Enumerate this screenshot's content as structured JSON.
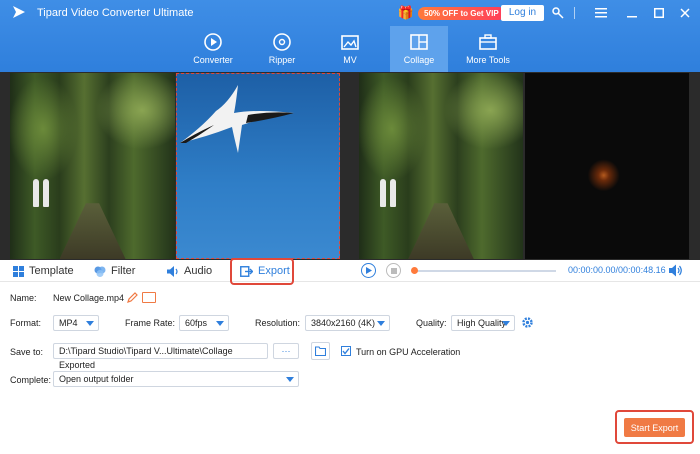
{
  "app": {
    "title": "Tipard Video Converter Ultimate",
    "promo": "50% OFF to Get VIP",
    "login": "Log in"
  },
  "nav": [
    {
      "label": "Converter",
      "icon": "converter-icon"
    },
    {
      "label": "Ripper",
      "icon": "ripper-icon"
    },
    {
      "label": "MV",
      "icon": "mv-icon"
    },
    {
      "label": "Collage",
      "icon": "collage-icon",
      "active": true
    },
    {
      "label": "More Tools",
      "icon": "toolbox-icon"
    }
  ],
  "tabs": {
    "template": "Template",
    "filter": "Filter",
    "audio": "Audio",
    "export": "Export"
  },
  "player": {
    "time": "00:00:00.00/00:00:48.16",
    "progress": 0.0
  },
  "settings": {
    "name_label": "Name:",
    "name_value": "New Collage.mp4",
    "format_label": "Format:",
    "format_value": "MP4",
    "framerate_label": "Frame Rate:",
    "framerate_value": "60fps",
    "resolution_label": "Resolution:",
    "resolution_value": "3840x2160 (4K)",
    "quality_label": "Quality:",
    "quality_value": "High Quality",
    "saveto_label": "Save to:",
    "saveto_value": "D:\\Tipard Studio\\Tipard V...Ultimate\\Collage Exported",
    "browse": "···",
    "gpu_label": "Turn on GPU Acceleration",
    "complete_label": "Complete:",
    "complete_value": "Open output folder"
  },
  "actions": {
    "start_export": "Start Export"
  },
  "colors": {
    "accent": "#2f7fdc",
    "highlight": "#e0483a",
    "export_button": "#f07a44"
  }
}
